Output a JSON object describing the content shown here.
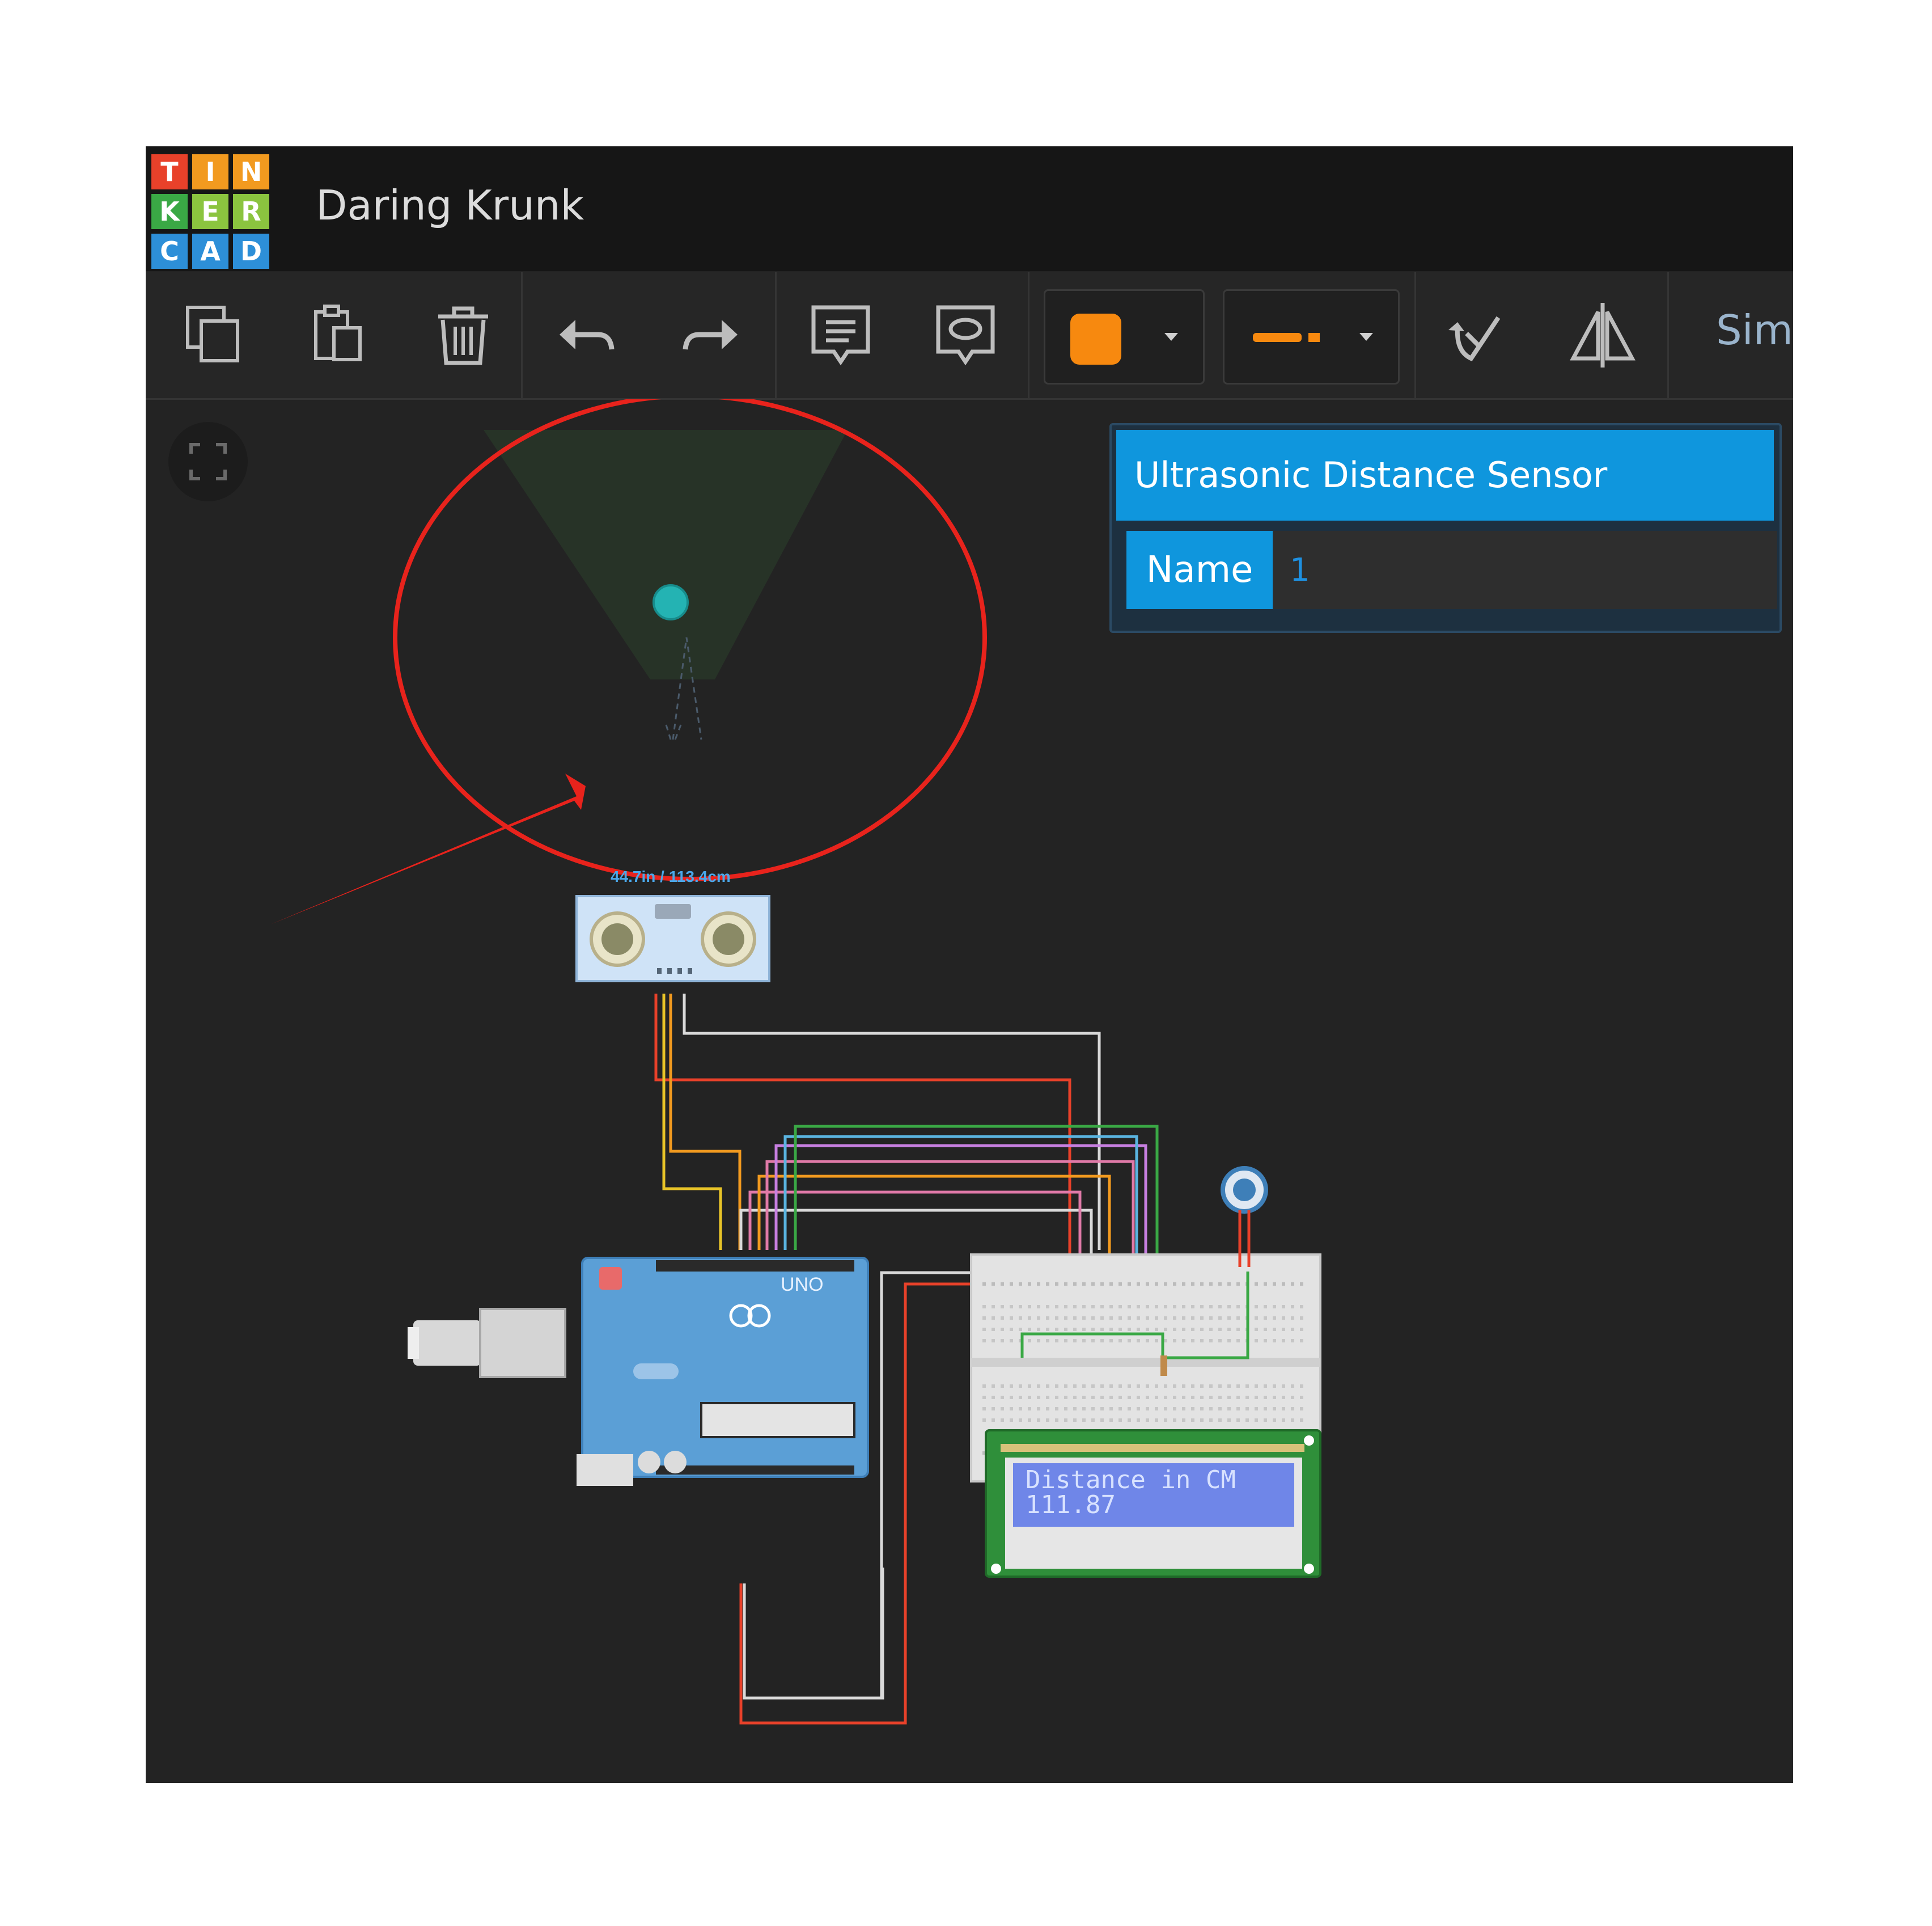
{
  "app": {
    "logo_letters": [
      "T",
      "I",
      "N",
      "K",
      "E",
      "R",
      "C",
      "A",
      "D"
    ],
    "title": "Daring Krunk"
  },
  "toolbar": {
    "buttons": [
      "copy-icon",
      "paste-icon",
      "delete-icon",
      "undo-icon",
      "redo-icon",
      "notes-icon",
      "annotation-icon",
      "color-picker",
      "wire-type-picker",
      "rotate-icon",
      "flip-icon"
    ],
    "color_value": "#f7890f",
    "simulate_label": "Sim"
  },
  "inspector": {
    "title": "Ultrasonic Distance Sensor",
    "name_label": "Name",
    "name_value": "1"
  },
  "circuit": {
    "sensor_reading": "44.7in / 113.4cm",
    "board_label": "UNO",
    "lcd_line1": "Distance in CM",
    "lcd_line2": "111.87"
  },
  "colors": {
    "annotation_red": "#e8231c",
    "accent_blue": "#0f96dd",
    "canvas_bg": "#232323"
  }
}
